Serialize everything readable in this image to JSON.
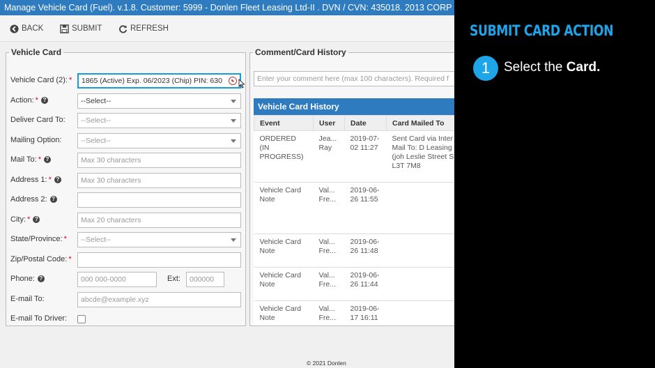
{
  "window": {
    "title": "Manage Vehicle Card (Fuel). v.1.8. Customer: 5999 - Donlen Fleet Leasing Ltd-II . DVN / CVN: 435018. 2013 CORP"
  },
  "toolbar": {
    "back_label": "BACK",
    "submit_label": "SUBMIT",
    "refresh_label": "REFRESH"
  },
  "vehicle_card": {
    "legend": "Vehicle Card",
    "fields": {
      "vehicle_card": {
        "label": "Vehicle Card (2):",
        "value": "1865 (Active) Exp. 06/2023 (Chip) PIN: 630"
      },
      "action": {
        "label": "Action:",
        "value": "--Select--"
      },
      "deliver_card_to": {
        "label": "Deliver Card To:",
        "value": "--Select--"
      },
      "mailing_option": {
        "label": "Mailing Option:",
        "value": "--Select--"
      },
      "mail_to": {
        "label": "Mail To:",
        "placeholder": "Max 30 characters"
      },
      "address1": {
        "label": "Address 1:",
        "placeholder": "Max 30 characters"
      },
      "address2": {
        "label": "Address 2:",
        "placeholder": ""
      },
      "city": {
        "label": "City:",
        "placeholder": "Max 20 characters"
      },
      "state": {
        "label": "State/Province:",
        "value": "--Select--"
      },
      "zip": {
        "label": "Zip/Postal Code:",
        "placeholder": ""
      },
      "phone": {
        "label": "Phone:",
        "placeholder": "000 000-0000",
        "ext_label": "Ext:",
        "ext_placeholder": "000000"
      },
      "email": {
        "label": "E-mail To:",
        "placeholder": "abcde@example.xyz"
      },
      "email_driver": {
        "label": "E-mail To Driver:",
        "checked": false
      }
    }
  },
  "history": {
    "legend": "Comment/Card History",
    "comment_placeholder": "Enter your comment here (max 100 characters). Required f",
    "table_title": "Vehicle Card History",
    "columns": [
      "Event",
      "User",
      "Date",
      "Card Mailed To"
    ],
    "rows": [
      {
        "event": "ORDERED (IN PROGRESS)",
        "user": "Jea... Ray",
        "date": "2019-07-02 11:27",
        "mailed": "Sent Card via Inter Priority. Mail To: D Leasing Ltd-II (joh Leslie Street Ste 2 ON L3T 7M8"
      },
      {
        "event": "Vehicle Card Note",
        "user": "Val... Fre...",
        "date": "2019-06-26 11:55",
        "mailed": ""
      },
      {
        "event": "Vehicle Card Note",
        "user": "Val... Fre...",
        "date": "2019-06-26 11:48",
        "mailed": ""
      },
      {
        "event": "Vehicle Card Note",
        "user": "Val... Fre...",
        "date": "2019-06-26 11:44",
        "mailed": ""
      },
      {
        "event": "Vehicle Card Note",
        "user": "Val... Fre...",
        "date": "2019-06-17 16:11",
        "mailed": ""
      }
    ]
  },
  "footer": {
    "copyright": "© 2021 Donlen"
  },
  "instruction": {
    "title": "SUBMIT CARD ACTION",
    "step_number": "1",
    "step_text_prefix": "Select the ",
    "step_text_bold": "Card."
  },
  "colors": {
    "primary_blue": "#2f7bbf",
    "accent_cyan": "#1ea4e8",
    "required_red": "#d0021b",
    "panel_bg": "#000000"
  }
}
